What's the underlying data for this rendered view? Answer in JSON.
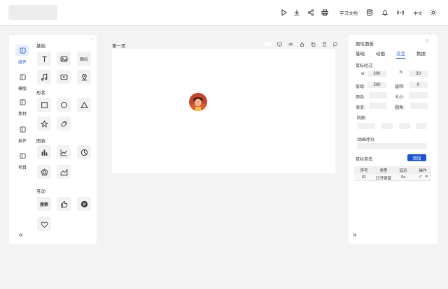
{
  "topbar": {
    "docs_label": "学习文档",
    "lang_label": "中文"
  },
  "left_nav": {
    "items": [
      {
        "label": "组件",
        "active": true
      },
      {
        "label": "模版",
        "active": false
      },
      {
        "label": "素材",
        "active": false
      },
      {
        "label": "插件",
        "active": false
      },
      {
        "label": "项目",
        "active": false
      }
    ],
    "collapse_label": "«"
  },
  "components": {
    "sections": {
      "basic": "基础",
      "shapes": "形状",
      "charts": "图表",
      "interactive": "互动"
    },
    "basic_tiles": {
      "icon_tile": "图标"
    },
    "interactive_tiles": {
      "search_tile": "搜索"
    }
  },
  "canvas": {
    "page_name": "第一页"
  },
  "properties": {
    "title": "属性面板",
    "tabs": [
      "基础",
      "动画",
      "交互",
      "数据"
    ],
    "active_tab": 2,
    "hover_label": "鼠标经过:",
    "w_label": "w:",
    "w_value": "200",
    "h_label": "h:",
    "h_value": "20",
    "layer_label": "层级:",
    "layer_value": "200",
    "rotate_label": "旋转:",
    "rotate_value": "0",
    "color_label": "颜色:",
    "size_label": "大小:",
    "gradient_label": "渐变:",
    "round_label": "圆角:",
    "shadow_label": "阴影:",
    "anim_time_label": "动画时间:",
    "click_label": "鼠标单击:",
    "add_button": "添加",
    "table": {
      "headers": [
        "序号",
        "类型",
        "延迟",
        "操作"
      ],
      "rows": [
        {
          "index": "01",
          "type": "打开弹窗",
          "delay": "0s"
        }
      ]
    },
    "expand_label": "»"
  },
  "colors": {
    "accent": "#1a56db",
    "tile_bg": "#f2f2f2",
    "page_bg": "#f3f3f3"
  }
}
